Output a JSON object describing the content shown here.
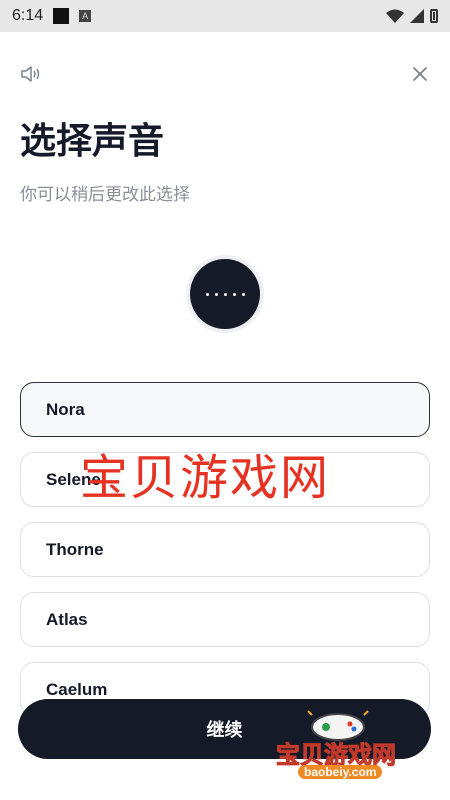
{
  "status_bar": {
    "time": "6:14",
    "notification_icons": [
      "black-square-icon",
      "a-box-icon"
    ],
    "system_icons": [
      "wifi-icon",
      "signal-icon",
      "battery-icon"
    ]
  },
  "header": {
    "speaker_icon": "speaker-icon",
    "close_icon": "close-icon"
  },
  "title": "选择声音",
  "subtitle": "你可以稍后更改此选择",
  "play_button": {
    "icon": "dots-icon"
  },
  "voices": [
    {
      "name": "Nora",
      "selected": true
    },
    {
      "name": "Selene",
      "selected": false
    },
    {
      "name": "Thorne",
      "selected": false
    },
    {
      "name": "Atlas",
      "selected": false
    },
    {
      "name": "Caelum",
      "selected": false
    }
  ],
  "continue_label": "继续",
  "watermark": {
    "center_text": "宝贝游戏网",
    "corner_text": "宝贝游戏网",
    "corner_url": "baobeiy.com"
  },
  "colors": {
    "primary": "#141a28",
    "subtitle": "#8a8f98",
    "border": "#dcdfe4",
    "watermark": "#e53222"
  }
}
